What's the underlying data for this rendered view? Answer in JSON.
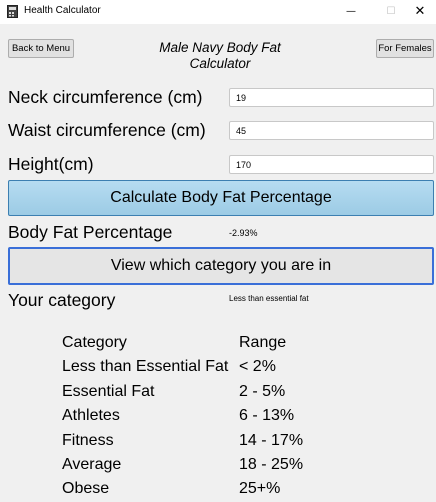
{
  "window": {
    "title": "Health Calculator",
    "minimize_glyph": "—",
    "maximize_glyph": "☐",
    "close_glyph": "✕",
    "icon": "calculator-app-icon"
  },
  "header": {
    "back_label": "Back to Menu",
    "title_line1": "Male Navy Body Fat",
    "title_line2": "Calculator",
    "females_label": "For Females"
  },
  "form": {
    "neck_label": "Neck circumference (cm)",
    "neck_value": "19",
    "waist_label": "Waist circumference (cm)",
    "waist_value": "45",
    "height_label": "Height(cm)",
    "height_value": "170"
  },
  "calculate_label": "Calculate Body Fat Percentage",
  "result": {
    "label": "Body Fat Percentage",
    "value": "-2.93%"
  },
  "view_category_label": "View which category you are in",
  "category": {
    "label": "Your category",
    "value": "Less than essential fat"
  },
  "table": {
    "headers": [
      "Category",
      "Range"
    ],
    "rows": [
      [
        "Less than Essential Fat",
        "< 2%"
      ],
      [
        "Essential Fat",
        "2 - 5%"
      ],
      [
        "Athletes",
        "6 - 13%"
      ],
      [
        "Fitness",
        "14 - 17%"
      ],
      [
        "Average",
        "18 - 25%"
      ],
      [
        "Obese",
        "25+%"
      ]
    ]
  },
  "colors": {
    "calculate_button": "#a8d4ec",
    "focus_border": "#3a6fd8",
    "background": "#f0f0f0"
  }
}
